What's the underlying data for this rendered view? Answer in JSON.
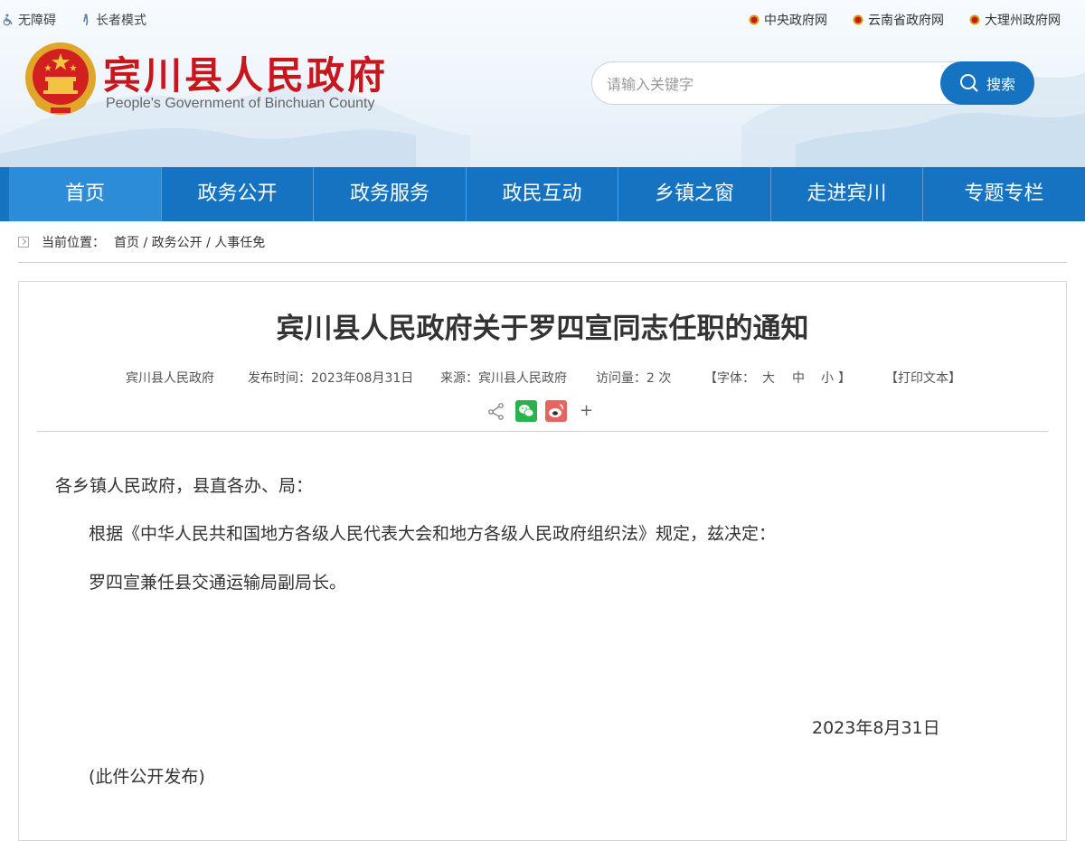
{
  "topbar": {
    "accessibility_label": "无障碍",
    "elderly_label": "长者模式"
  },
  "gov_links": [
    "中央政府网",
    "云南省政府网",
    "大理州政府网"
  ],
  "site": {
    "title": "宾川县人民政府",
    "subtitle": "People's Government of Binchuan County"
  },
  "search": {
    "placeholder": "请输入关键字",
    "button_label": "搜索"
  },
  "nav": [
    "首页",
    "政务公开",
    "政务服务",
    "政民互动",
    "乡镇之窗",
    "走进宾川",
    "专题专栏"
  ],
  "breadcrumb": {
    "prefix": "当前位置：",
    "path": "首页 / 政务公开 / 人事任免"
  },
  "article": {
    "title": "宾川县人民政府关于罗四宣同志任职的通知",
    "meta": {
      "author": "宾川县人民政府",
      "publish": "发布时间：2023年08月31日",
      "source": "来源：宾川县人民政府",
      "visits": "访问量：2 次",
      "font_label": "【字体：",
      "font_large": "大",
      "font_medium": "中",
      "font_small": "小",
      "font_end": "】",
      "print": "【打印文本】"
    },
    "share_plus": "+",
    "salutation": "各乡镇人民政府，县直各办、局：",
    "body": [
      "根据《中华人民共和国地方各级人民代表大会和地方各级人民政府组织法》规定，兹决定：",
      "罗四宣兼任县交通运输局副局长。"
    ],
    "date": "2023年8月31日",
    "note": "(此件公开发布)"
  },
  "colors": {
    "nav_blue": "#1673c1",
    "title_red": "#c8161d"
  }
}
